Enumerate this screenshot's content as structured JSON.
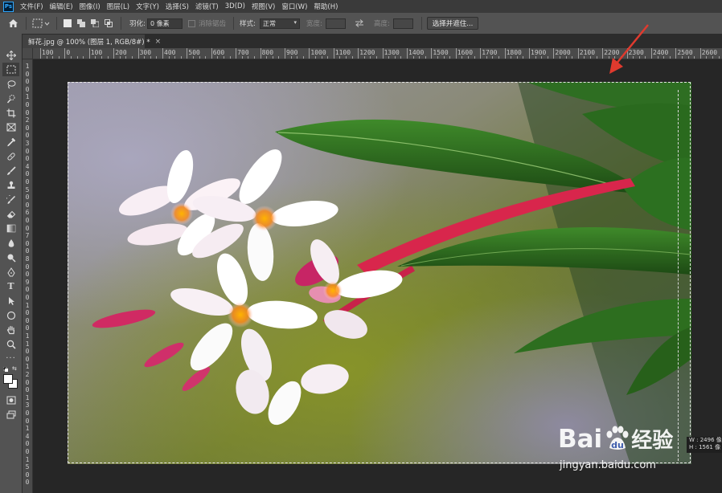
{
  "app": {
    "logo_text": "Ps"
  },
  "menu": {
    "items": [
      "文件(F)",
      "编辑(E)",
      "图像(I)",
      "图层(L)",
      "文字(Y)",
      "选择(S)",
      "滤镜(T)",
      "3D(D)",
      "视图(V)",
      "窗口(W)",
      "帮助(H)"
    ]
  },
  "options": {
    "feather_label": "羽化:",
    "feather_value": "0 像素",
    "antialias_label": "消除锯齿",
    "style_label": "样式:",
    "style_value": "正常",
    "width_label": "宽度:",
    "height_label": "高度:",
    "select_mask_button": "选择并遮住..."
  },
  "document": {
    "tab_title": "鲜花.jpg @ 100% (图层 1, RGB/8#) *",
    "close_glyph": "×"
  },
  "ruler": {
    "top_labels": [
      "100",
      "0",
      "100",
      "200",
      "300",
      "400",
      "500",
      "600",
      "700",
      "800",
      "900",
      "1000",
      "1100",
      "1200",
      "1300",
      "1400",
      "1500",
      "1600",
      "1700",
      "1800",
      "1900",
      "2000",
      "2100",
      "2200",
      "2300",
      "2400",
      "2500",
      "2600"
    ],
    "left_labels": [
      "1",
      "0",
      "0",
      "0",
      "1",
      "0",
      "0",
      "2",
      "0",
      "0",
      "3",
      "0",
      "0",
      "4",
      "0",
      "0",
      "5",
      "0",
      "0",
      "6",
      "0",
      "0",
      "7",
      "0",
      "0",
      "8",
      "0",
      "0",
      "9",
      "0",
      "0",
      "1",
      "0",
      "0",
      "0",
      "1",
      "1",
      "0",
      "0",
      "1",
      "2",
      "0",
      "0",
      "1",
      "3",
      "0",
      "0",
      "1",
      "4",
      "0",
      "0",
      "1",
      "5",
      "0",
      "0"
    ]
  },
  "info": {
    "width": "W : 2496 像",
    "height": "H : 1561 像"
  },
  "watermark": {
    "brand": "Bai",
    "brand2": "du",
    "cn": "经验",
    "url": "jingyan.baidu.com"
  },
  "colors": {
    "accent_arrow": "#e03a2e",
    "ui_dark": "#535353",
    "menubar": "#3a3a3a"
  }
}
